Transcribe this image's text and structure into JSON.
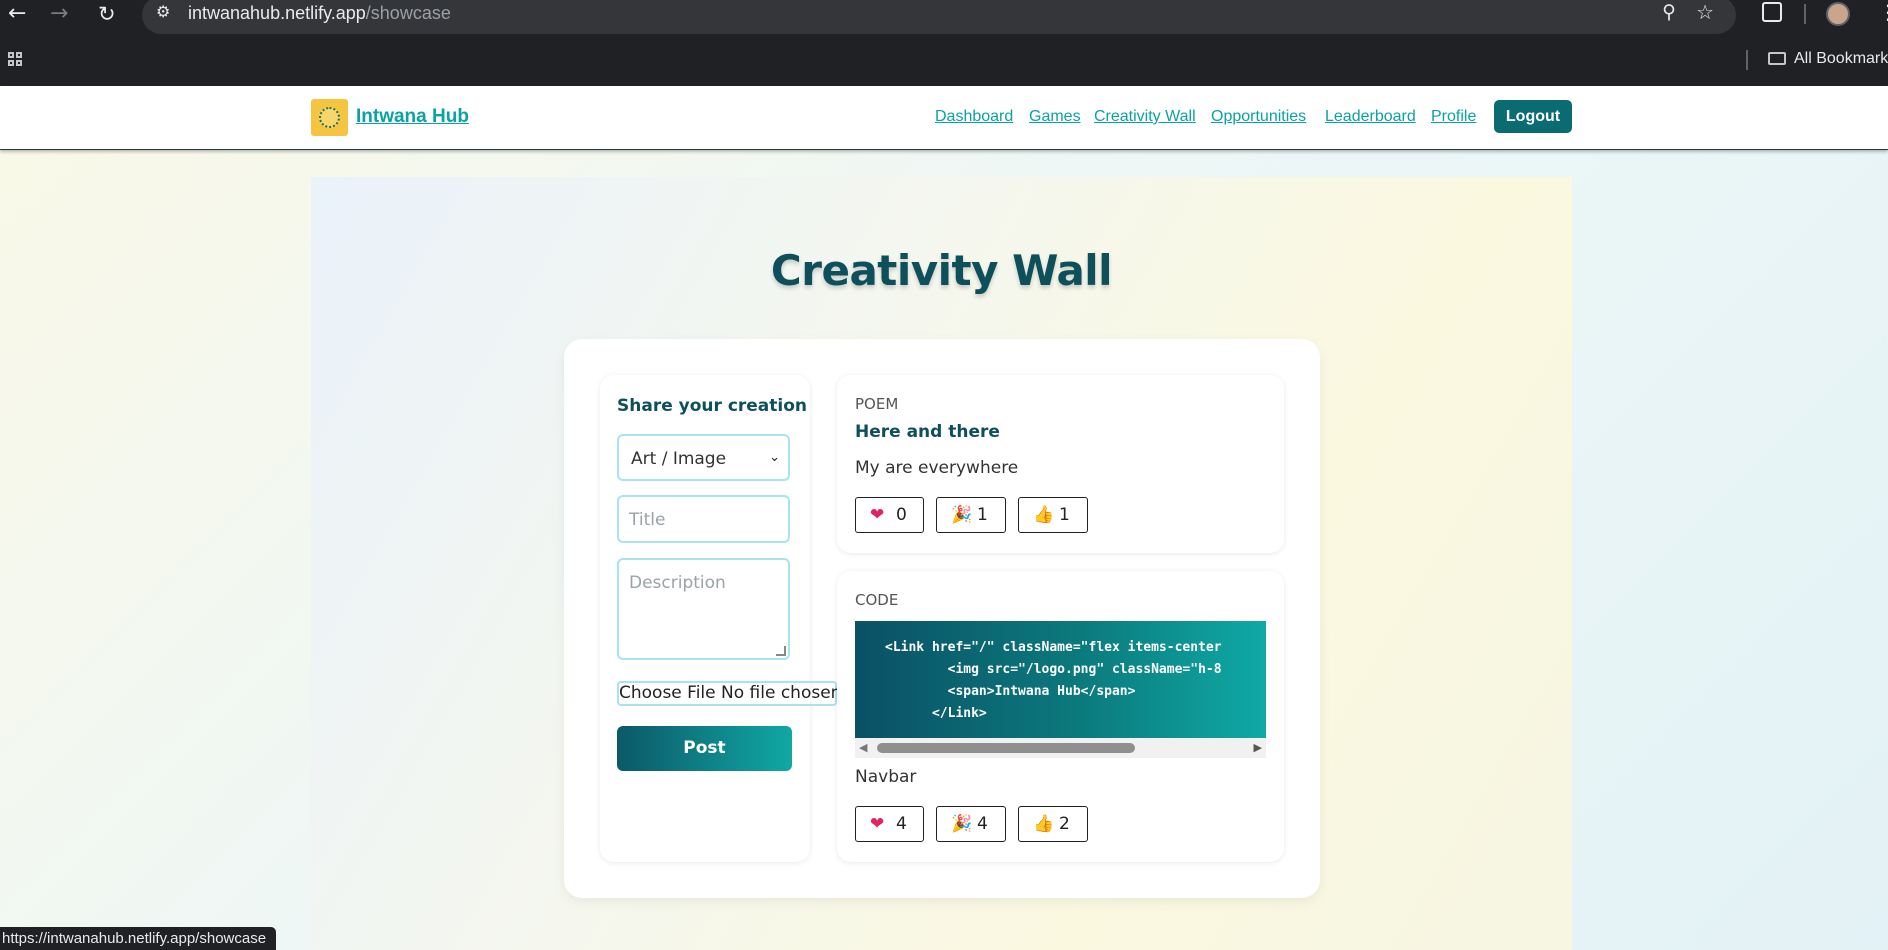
{
  "browser": {
    "url_host": "intwanahub.netlify.app",
    "url_path": "/showcase",
    "bookmarks_label": "All Bookmarks",
    "status_url": "https://intwanahub.netlify.app/showcase"
  },
  "nav": {
    "brand": "Intwana Hub",
    "links": [
      "Dashboard",
      "Games",
      "Creativity Wall",
      "Opportunities",
      "Leaderboard",
      "Profile"
    ],
    "logout": "Logout"
  },
  "page": {
    "title": "Creativity Wall"
  },
  "form": {
    "heading": "Share your creation",
    "type_selected": "Art / Image",
    "title_placeholder": "Title",
    "description_placeholder": "Description",
    "file_label": "Choose File No file chosen",
    "post_label": "Post"
  },
  "posts": [
    {
      "type": "POEM",
      "title": "Here and there",
      "description": "My are everywhere",
      "reactions": [
        {
          "icon": "heart-icon",
          "emoji": "❤",
          "count": "0"
        },
        {
          "icon": "party-popper-icon",
          "emoji": "🎉",
          "count": "1"
        },
        {
          "icon": "thumbs-up-icon",
          "emoji": "👍",
          "count": "1"
        }
      ]
    },
    {
      "type": "CODE",
      "code": "<Link href=\"/\" className=\"flex items-center\n        <img src=\"/logo.png\" className=\"h-8\n        <span>Intwana Hub</span>\n      </Link>",
      "description": "Navbar",
      "reactions": [
        {
          "icon": "heart-icon",
          "emoji": "❤",
          "count": "4"
        },
        {
          "icon": "party-popper-icon",
          "emoji": "🎉",
          "count": "4"
        },
        {
          "icon": "thumbs-up-icon",
          "emoji": "👍",
          "count": "2"
        }
      ]
    }
  ],
  "colors": {
    "accent": "#0aa3a3",
    "heading": "#0e4f5c",
    "logout_bg": "#0b6b73"
  }
}
